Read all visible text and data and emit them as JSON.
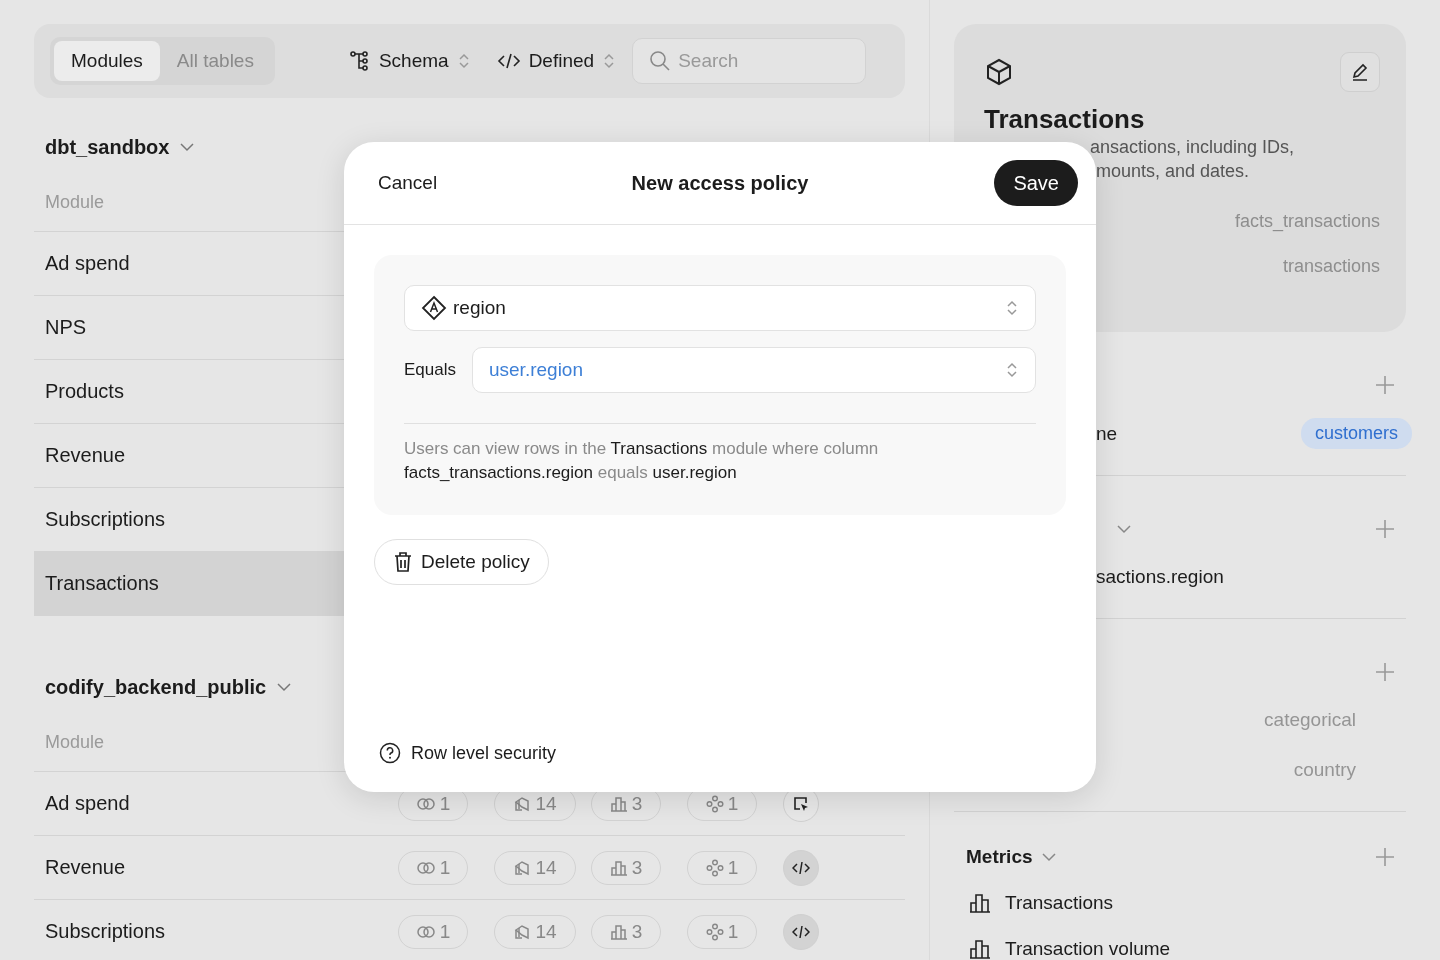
{
  "toolbar": {
    "view_tabs": [
      {
        "label": "Modules",
        "selected": true
      },
      {
        "label": "All tables",
        "selected": false
      }
    ],
    "schema_select": "Schema",
    "source_select": "Defined",
    "search": {
      "placeholder": "Search"
    }
  },
  "groups": [
    {
      "name": "dbt_sandbox",
      "column_header": "Module",
      "rows": [
        {
          "name": "Ad spend",
          "selected": false
        },
        {
          "name": "NPS",
          "selected": false
        },
        {
          "name": "Products",
          "selected": false
        },
        {
          "name": "Revenue",
          "selected": false
        },
        {
          "name": "Subscriptions",
          "selected": false
        },
        {
          "name": "Transactions",
          "selected": true
        }
      ]
    },
    {
      "name": "codify_backend_public",
      "column_header": "Module",
      "rows": [
        {
          "name": "Ad spend",
          "selected": false,
          "counts": [
            "1",
            "14",
            "3",
            "1"
          ],
          "kind": "cursor"
        },
        {
          "name": "Revenue",
          "selected": false,
          "counts": [
            "1",
            "14",
            "3",
            "1"
          ],
          "kind": "code"
        },
        {
          "name": "Subscriptions",
          "selected": false,
          "counts": [
            "1",
            "14",
            "3",
            "1"
          ],
          "kind": "code"
        }
      ]
    }
  ],
  "detail": {
    "title": "Transactions",
    "description_fragments": [
      "ansactions, including IDs,",
      "mounts, and dates."
    ],
    "properties": [
      "facts_transactions",
      "transactions"
    ],
    "sections": [
      {
        "rows": [
          {
            "label": "ne",
            "tag": "customers"
          }
        ]
      },
      {
        "expanded": true,
        "rows": [
          {
            "label": "sactions.region"
          }
        ]
      },
      {
        "rows": [
          {
            "value": "categorical"
          },
          {
            "value": "country"
          }
        ]
      }
    ],
    "metrics": {
      "title": "Metrics",
      "expanded": true,
      "items": [
        "Transactions",
        "Transaction volume"
      ]
    }
  },
  "modal": {
    "cancel": "Cancel",
    "title": "New access policy",
    "save": "Save",
    "column_select": "region",
    "operator": "Equals",
    "value_select": "user.region",
    "summary": "Users can view rows in the **Transactions** module where column **facts_transactions.region** equals **user.region**",
    "delete": "Delete policy",
    "footer_link": "Row level security"
  }
}
